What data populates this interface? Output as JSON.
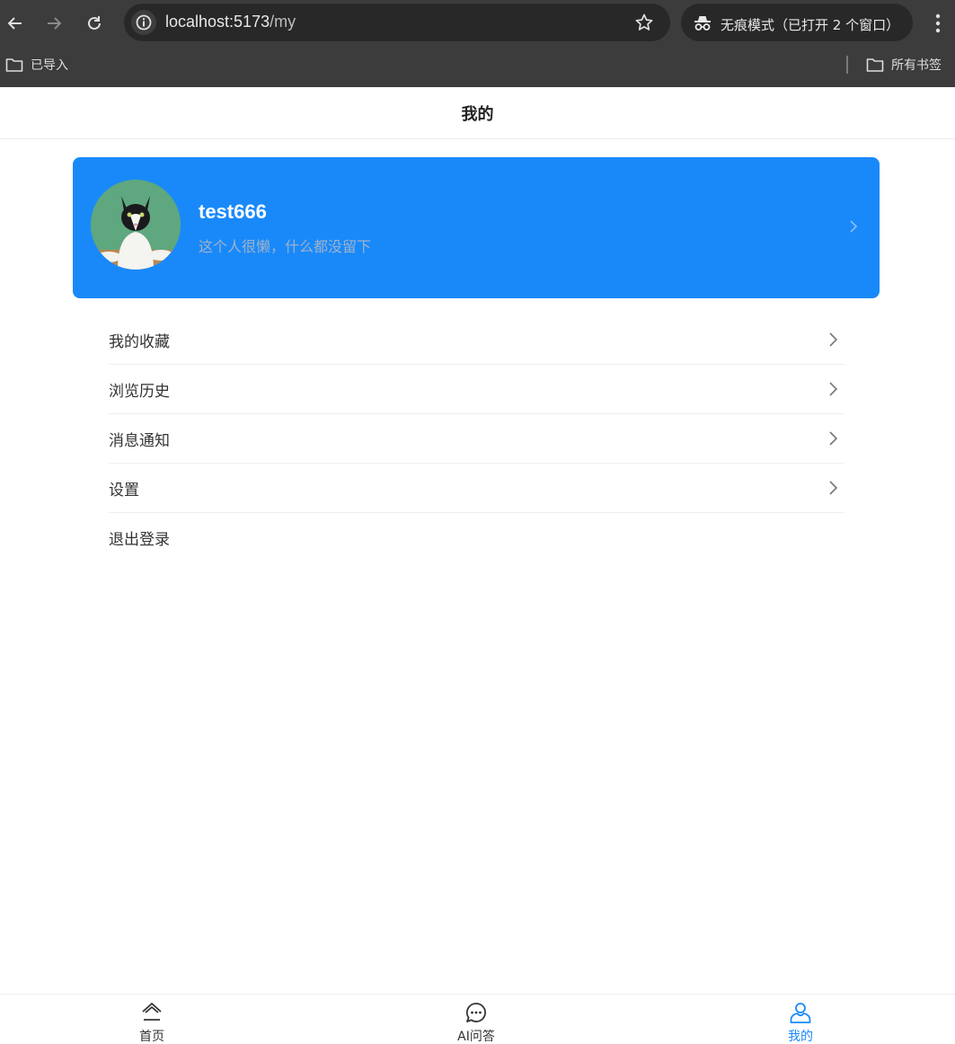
{
  "browser": {
    "url_host": "localhost:5173",
    "url_path": "/my",
    "incognito_label": "无痕模式（已打开 2 个窗口）",
    "bookmarks": {
      "imported": "已导入",
      "all": "所有书签"
    },
    "icons": [
      "back-arrow-icon",
      "forward-arrow-icon",
      "reload-icon",
      "site-info-icon",
      "bookmark-star-icon",
      "incognito-icon",
      "more-menu-icon",
      "folder-icon"
    ]
  },
  "page": {
    "title": "我的"
  },
  "profile": {
    "username": "test666",
    "bio": "这个人很懒，什么都没留下",
    "card_color": "#1989fa"
  },
  "menu": {
    "items": [
      {
        "label": "我的收藏",
        "arrow": true
      },
      {
        "label": "浏览历史",
        "arrow": true
      },
      {
        "label": "消息通知",
        "arrow": true
      },
      {
        "label": "设置",
        "arrow": true
      },
      {
        "label": "退出登录",
        "arrow": false
      }
    ]
  },
  "tabbar": {
    "items": [
      {
        "label": "首页",
        "icon": "home-icon"
      },
      {
        "label": "AI问答",
        "icon": "chat-icon"
      },
      {
        "label": "我的",
        "icon": "user-icon",
        "active": true
      }
    ],
    "active_color": "#1989fa"
  }
}
